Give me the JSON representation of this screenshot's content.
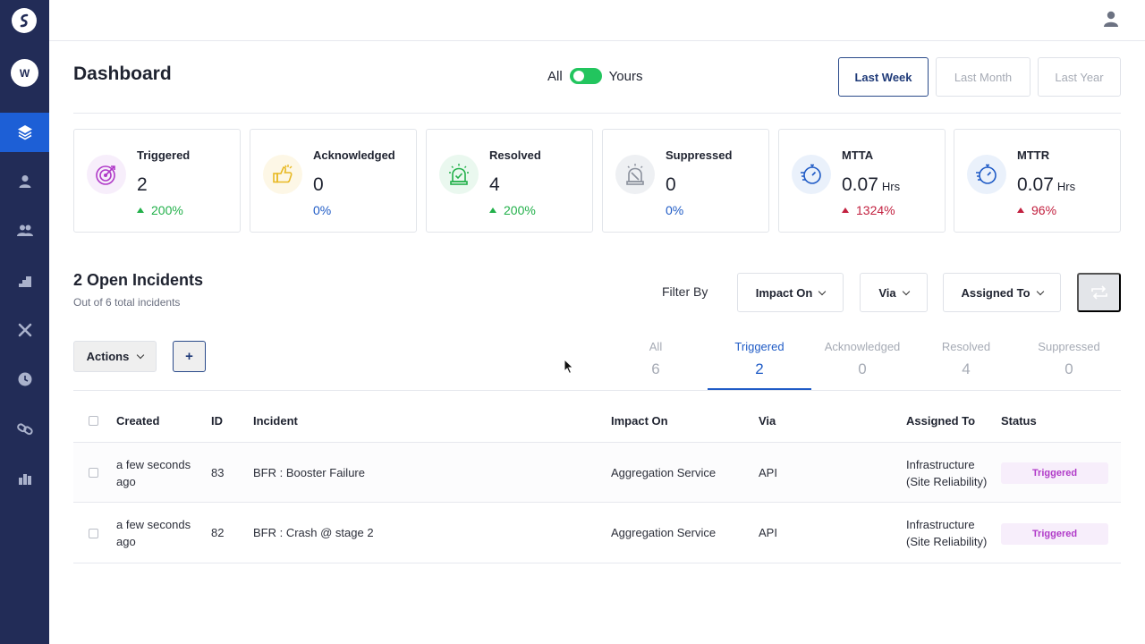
{
  "sidebar": {
    "workspace_initial": "W",
    "items": [
      {
        "name": "layers-icon",
        "active": true
      },
      {
        "name": "user-icon",
        "active": false
      },
      {
        "name": "team-icon",
        "active": false
      },
      {
        "name": "stairs-icon",
        "active": false
      },
      {
        "name": "tools-icon",
        "active": false
      },
      {
        "name": "clock-icon",
        "active": false
      },
      {
        "name": "link-icon",
        "active": false
      },
      {
        "name": "chart-icon",
        "active": false
      }
    ]
  },
  "header": {
    "title": "Dashboard",
    "toggle": {
      "left": "All",
      "right": "Yours"
    },
    "ranges": [
      "Last Week",
      "Last Month",
      "Last Year"
    ]
  },
  "stats": [
    {
      "label": "Triggered",
      "value": "2",
      "unit": "",
      "change": "200%",
      "trend": "up",
      "color": "#22b04a",
      "icon": "target-icon",
      "icon_bg": "#f7eefb"
    },
    {
      "label": "Acknowledged",
      "value": "0",
      "unit": "",
      "change": "0%",
      "trend": "none",
      "color": "#1f5bc6",
      "icon": "thumbs-up-icon",
      "icon_bg": "#fdf7e6"
    },
    {
      "label": "Resolved",
      "value": "4",
      "unit": "",
      "change": "200%",
      "trend": "up",
      "color": "#22b04a",
      "icon": "alarm-check-icon",
      "icon_bg": "#eaf8ef"
    },
    {
      "label": "Suppressed",
      "value": "0",
      "unit": "",
      "change": "0%",
      "trend": "none",
      "color": "#1f5bc6",
      "icon": "alarm-muted-icon",
      "icon_bg": "#eef0f3"
    },
    {
      "label": "MTTA",
      "value": "0.07",
      "unit": "Hrs",
      "change": "1324%",
      "trend": "up",
      "color": "#c2203f",
      "icon": "stopwatch-icon",
      "icon_bg": "#eaf1fb"
    },
    {
      "label": "MTTR",
      "value": "0.07",
      "unit": "Hrs",
      "change": "96%",
      "trend": "up",
      "color": "#c2203f",
      "icon": "stopwatch-icon",
      "icon_bg": "#eaf1fb"
    }
  ],
  "incidents_summary": {
    "title": "2 Open Incidents",
    "subtitle": "Out of 6 total incidents"
  },
  "filters": {
    "label": "Filter By",
    "dropdowns": [
      "Impact On",
      "Via",
      "Assigned To"
    ]
  },
  "toolbar": {
    "actions_label": "Actions",
    "add_label": "+"
  },
  "status_tabs": [
    {
      "label": "All",
      "count": "6",
      "active": false
    },
    {
      "label": "Triggered",
      "count": "2",
      "active": true
    },
    {
      "label": "Acknowledged",
      "count": "0",
      "active": false
    },
    {
      "label": "Resolved",
      "count": "4",
      "active": false
    },
    {
      "label": "Suppressed",
      "count": "0",
      "active": false
    }
  ],
  "table": {
    "columns": [
      "Created",
      "ID",
      "Incident",
      "Impact On",
      "Via",
      "Assigned To",
      "Status"
    ],
    "rows": [
      {
        "created_1": "a few seconds",
        "created_2": "ago",
        "id": "83",
        "incident": "BFR : Booster Failure",
        "impact": "Aggregation Service",
        "via": "API",
        "assigned_1": "Infrastructure",
        "assigned_2": "(Site Reliability)",
        "status": "Triggered"
      },
      {
        "created_1": "a few seconds",
        "created_2": "ago",
        "id": "82",
        "incident": "BFR : Crash @ stage 2",
        "impact": "Aggregation Service",
        "via": "API",
        "assigned_1": "Infrastructure",
        "assigned_2": "(Site Reliability)",
        "status": "Triggered"
      }
    ]
  }
}
